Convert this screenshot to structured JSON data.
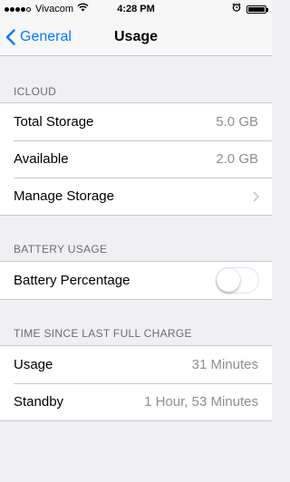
{
  "status_bar": {
    "carrier": "Vivacom",
    "time": "4:28 PM",
    "signal_bars": 4,
    "signal_max": 5
  },
  "nav": {
    "back_label": "General",
    "title": "Usage"
  },
  "icloud": {
    "header": "ICLOUD",
    "total_storage_label": "Total Storage",
    "total_storage_value": "5.0 GB",
    "available_label": "Available",
    "available_value": "2.0 GB",
    "manage_storage_label": "Manage Storage"
  },
  "battery_usage": {
    "header": "BATTERY USAGE",
    "battery_percentage_label": "Battery Percentage",
    "battery_percentage_on": false
  },
  "charge": {
    "header": "TIME SINCE LAST FULL CHARGE",
    "usage_label": "Usage",
    "usage_value": "31 Minutes",
    "standby_label": "Standby",
    "standby_value": "1 Hour, 53 Minutes"
  },
  "colors": {
    "accent": "#007aff",
    "background": "#efeff4",
    "secondary_text": "#8e8e93"
  }
}
